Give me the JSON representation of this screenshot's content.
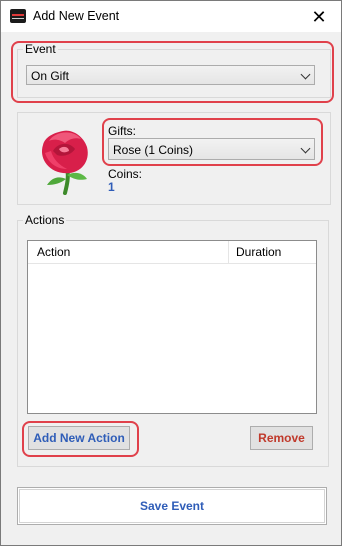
{
  "window": {
    "title": "Add New Event",
    "close_glyph": "✕"
  },
  "event": {
    "label": "Event",
    "selected": "On Gift"
  },
  "gift": {
    "gifts_label": "Gifts:",
    "selected": "Rose (1 Coins)",
    "coins_label": "Coins:",
    "coins_value": "1",
    "image_icon": "rose-icon"
  },
  "actions": {
    "label": "Actions",
    "columns": [
      "Action",
      "Duration"
    ],
    "rows": []
  },
  "buttons": {
    "add_action": "Add New Action",
    "remove": "Remove",
    "save": "Save Event"
  },
  "colors": {
    "highlight": "#e0414b",
    "link_blue": "#2f5db8",
    "remove_red": "#c0392b"
  }
}
